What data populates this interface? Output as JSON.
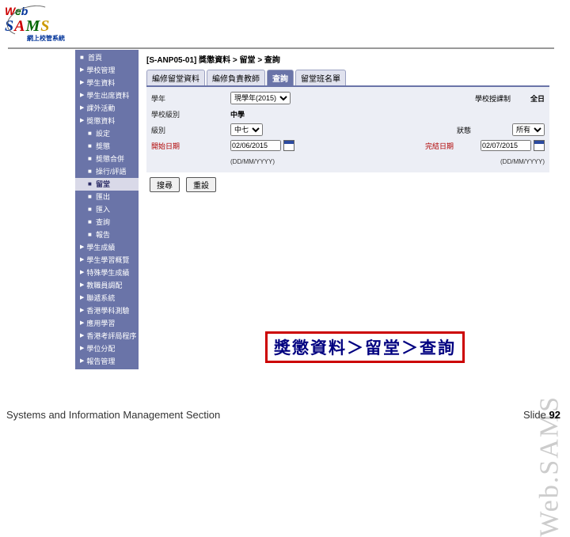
{
  "logo": {
    "sub": "網上校管系統"
  },
  "sidebar": {
    "items": [
      {
        "label": "首頁",
        "type": "top"
      },
      {
        "label": "學校管理",
        "type": "group"
      },
      {
        "label": "學生資料",
        "type": "group"
      },
      {
        "label": "學生出席資料",
        "type": "group"
      },
      {
        "label": "課外活動",
        "type": "group"
      },
      {
        "label": "獎懲資料",
        "type": "group"
      },
      {
        "label": "設定",
        "type": "sub"
      },
      {
        "label": "獎懲",
        "type": "sub"
      },
      {
        "label": "獎懲合併",
        "type": "sub"
      },
      {
        "label": "操行/評語",
        "type": "sub"
      },
      {
        "label": "留堂",
        "type": "sub",
        "active": true
      },
      {
        "label": "匯出",
        "type": "sub"
      },
      {
        "label": "匯入",
        "type": "sub"
      },
      {
        "label": "查詢",
        "type": "sub"
      },
      {
        "label": "報告",
        "type": "sub"
      },
      {
        "label": "學生成績",
        "type": "group"
      },
      {
        "label": "學生學習概覽",
        "type": "group"
      },
      {
        "label": "特殊學生成績",
        "type": "group"
      },
      {
        "label": "教職員調配",
        "type": "group"
      },
      {
        "label": "聯遞系統",
        "type": "group"
      },
      {
        "label": "香港學科測驗",
        "type": "group"
      },
      {
        "label": "應用學習",
        "type": "group"
      },
      {
        "label": "香港考評局程序",
        "type": "group"
      },
      {
        "label": "學位分配",
        "type": "group"
      },
      {
        "label": "報告管理",
        "type": "group"
      }
    ]
  },
  "breadcrumb": {
    "code": "[S-ANP05-01]",
    "path": "獎懲資料 > 留堂 > 查詢"
  },
  "tabs": [
    {
      "label": "編修留堂資料"
    },
    {
      "label": "編修負責教師"
    },
    {
      "label": "查詢",
      "active": true
    },
    {
      "label": "留堂班名單"
    }
  ],
  "form": {
    "year_label": "學年",
    "year_value": "現學年(2015)",
    "class_level_label": "學校級別",
    "class_level_value": "中學",
    "class_level_end_label": "學校授課制",
    "class_level_end_value": "全日",
    "class_label": "級別",
    "class_value": "中七",
    "weekday_label": "",
    "status_label": "狀態",
    "status_value": "所有",
    "start_label": "開始日期",
    "start_value": "02/06/2015",
    "end_label": "完結日期",
    "end_value": "02/07/2015",
    "date_hint": "(DD/MM/YYYY)",
    "btn_search": "搜尋",
    "btn_reset": "重設"
  },
  "callout": "獎懲資料＞留堂＞查詢",
  "watermark": "Web.SAMS",
  "footer": {
    "left": "Systems and Information Management Section",
    "right_label": "Slide",
    "right_num": "92"
  }
}
